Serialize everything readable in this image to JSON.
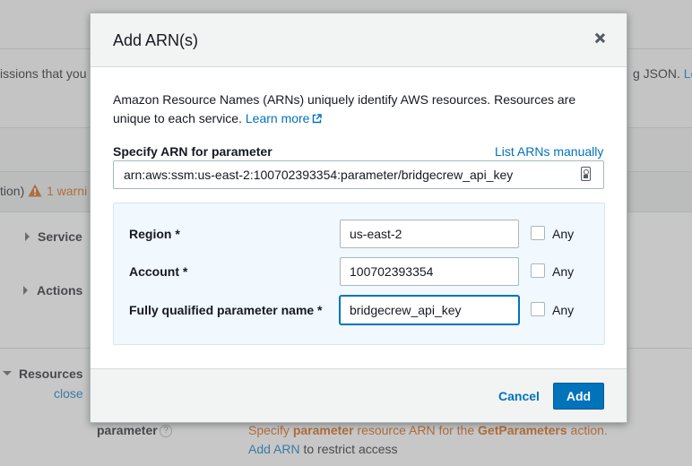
{
  "background": {
    "permissions_text": "issions that you",
    "permissions_right_text": "g JSON.",
    "permissions_right_link": "Lea",
    "warning_prefix": "tion)",
    "warning_count": "1 warni",
    "service_label": "Service",
    "actions_label": "Actions",
    "resources_label": "Resources",
    "close_link": "close",
    "parameter_label": "parameter",
    "help_symbol": "?",
    "spec_prefix": "Specify ",
    "spec_bold1": "parameter",
    "spec_mid": " resource ARN for the ",
    "spec_bold2": "GetParameters",
    "spec_suffix": " action.",
    "add_arn_link": "Add ARN",
    "add_arn_suffix": " to restrict access"
  },
  "modal": {
    "title": "Add ARN(s)",
    "description": "Amazon Resource Names (ARNs) uniquely identify AWS resources. Resources are unique to each service.",
    "learn_more": "Learn more",
    "specify_label": "Specify ARN for parameter",
    "list_manually": "List ARNs manually",
    "arn_value": "arn:aws:ssm:us-east-2:100702393354:parameter/bridgecrew_api_key",
    "fields": [
      {
        "label": "Region *",
        "value": "us-east-2",
        "any": "Any"
      },
      {
        "label": "Account *",
        "value": "100702393354",
        "any": "Any"
      },
      {
        "label": "Fully qualified parameter name *",
        "value": "bridgecrew_api_key",
        "any": "Any"
      }
    ],
    "cancel": "Cancel",
    "add": "Add"
  },
  "colors": {
    "link": "#0073bb",
    "primary_button": "#0073bb",
    "warning": "#d45b07"
  },
  "icons": {
    "close": "close-icon",
    "external_link": "external-link-icon",
    "copy": "copy-icon",
    "warning": "warning-icon"
  }
}
